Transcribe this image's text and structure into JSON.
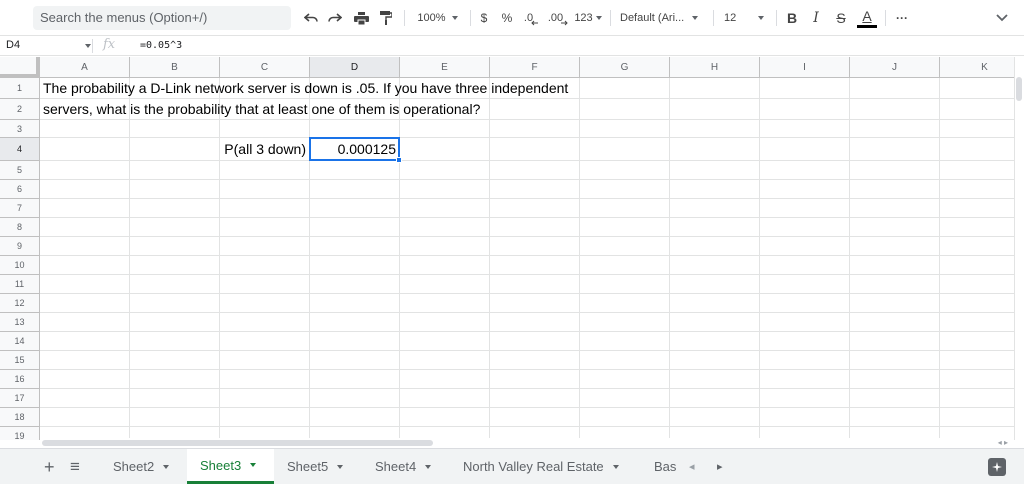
{
  "toolbar": {
    "menu_search_placeholder": "Search the menus (Option+/)",
    "zoom": "100%",
    "currency_label": "$",
    "percent_label": "%",
    "decrease_decimal_label": ".0",
    "increase_decimal_label": ".00",
    "number_format_label": "123",
    "font_family": "Default (Ari...",
    "font_size": "12",
    "bold_label": "B",
    "italic_label": "I",
    "strike_label": "S",
    "text_color_label": "A",
    "more_label": "···",
    "text_color_bar": "#000000"
  },
  "formula_bar": {
    "cell_ref": "D4",
    "fx_label": "fx",
    "formula": "=0.05^3"
  },
  "grid": {
    "columns": [
      "A",
      "B",
      "C",
      "D",
      "E",
      "F",
      "G",
      "H",
      "I",
      "J",
      "K"
    ],
    "rows": [
      "1",
      "2",
      "3",
      "4",
      "5",
      "6",
      "7",
      "8",
      "9",
      "10",
      "11",
      "12",
      "13",
      "14",
      "15",
      "16",
      "17",
      "18",
      "19"
    ],
    "active_column": "D",
    "active_row": "4",
    "cells": {
      "A1": "The probability a D-Link network server is down is .05. If you have three independent",
      "A2": "servers, what is the probability that at least one of them is operational?",
      "C4": "P(all 3 down)",
      "D4": "0.000125"
    },
    "selection_color": "#1a73e8"
  },
  "sheet_tabs": {
    "add_label": "+",
    "list_label": "≡",
    "tabs": [
      {
        "label": "Sheet2",
        "active": false
      },
      {
        "label": "Sheet3",
        "active": true
      },
      {
        "label": "Sheet5",
        "active": false
      },
      {
        "label": "Sheet4",
        "active": false
      },
      {
        "label": "North Valley Real Estate",
        "active": false
      },
      {
        "label": "Bas",
        "active": false
      }
    ],
    "prev_label": "◂",
    "next_label": "▸",
    "active_color": "#188038"
  }
}
